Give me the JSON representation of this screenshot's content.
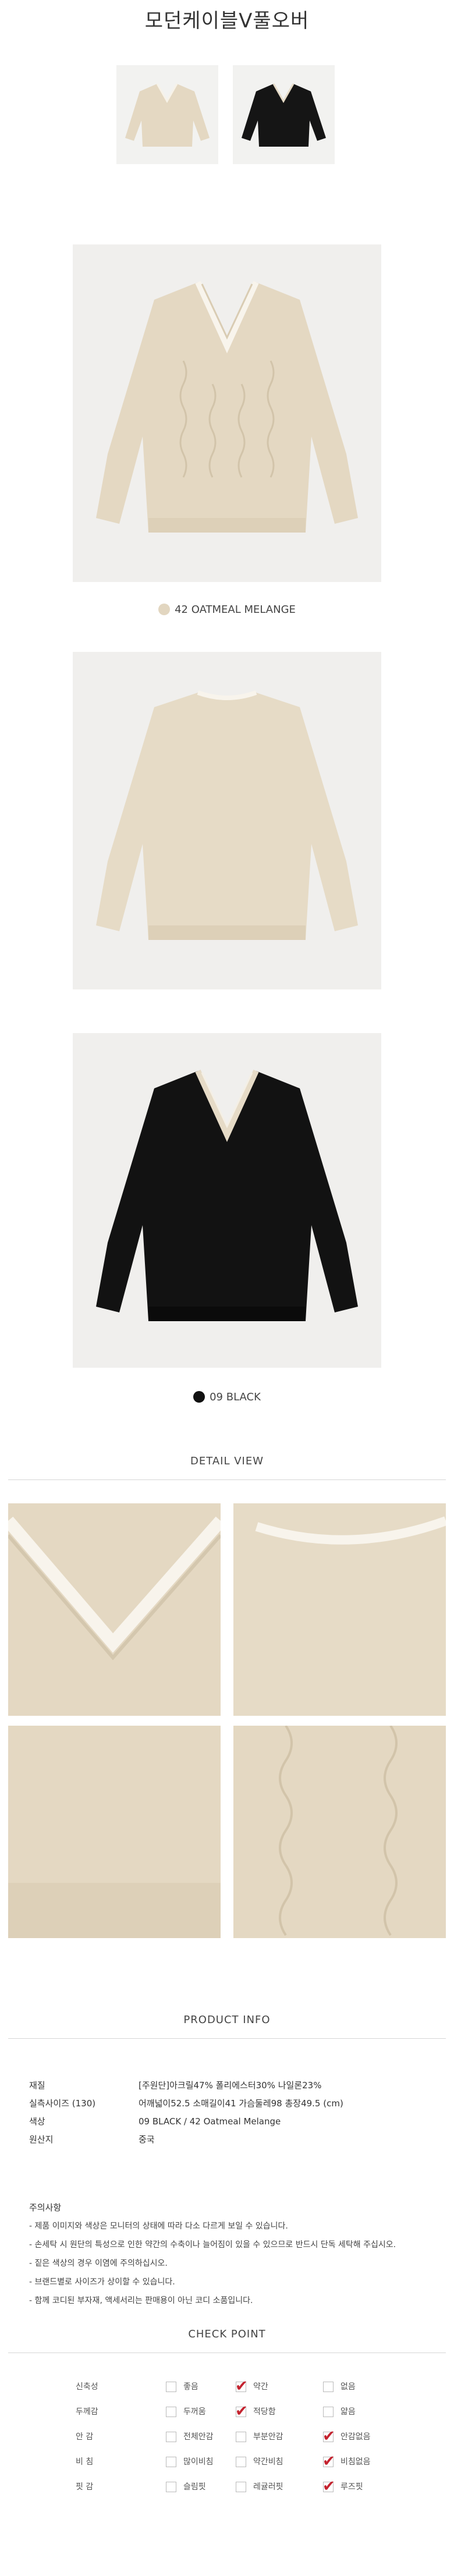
{
  "page_title": "모던케이블V풀오버",
  "colors": {
    "oatmeal": "#e6dbc7",
    "black": "#141414",
    "check_red": "#c4232f",
    "divider": "#d6d6d6"
  },
  "swatches": [
    {
      "caption": "42 OATMEAL MELANGE",
      "color": "#e2d6c0"
    },
    {
      "caption": "09 BLACK",
      "color": "#111111"
    }
  ],
  "detail_view": {
    "title": "DETAIL VIEW"
  },
  "product_info": {
    "title": "PRODUCT INFO",
    "rows": [
      {
        "label": "재질",
        "value": "[주원단]아크릴47% 폴리에스터30% 나일론23%"
      },
      {
        "label": "실측사이즈 (130)",
        "value": "어깨넓이52.5 소매길이41 가슴둘레98 총장49.5 (cm)"
      },
      {
        "label": "색상",
        "value": "09 BLACK / 42 Oatmeal Melange"
      },
      {
        "label": "원산지",
        "value": "중국"
      }
    ]
  },
  "notes": {
    "heading": "주의사항",
    "items": [
      "- 제품 이미지와 색상은 모니터의 상태에 따라 다소 다르게 보일 수 있습니다.",
      "- 손세탁 시 원단의 특성으로 인한 약간의 수축이나 늘어짐이 있을 수 있으므로 반드시 단독 세탁해 주십시오.",
      "- 짙은 색상의 경우 이염에 주의하십시오.",
      "- 브랜드별로 사이즈가 상이할 수 있습니다.",
      "- 함께 코디된 부자재, 액세서리는 판매용이 아닌 코디 소품입니다."
    ]
  },
  "check_point": {
    "title": "CHECK POINT",
    "rows": [
      {
        "label": "신축성",
        "options": [
          {
            "text": "좋음",
            "checked": false
          },
          {
            "text": "약간",
            "checked": true
          },
          {
            "text": "없음",
            "checked": false
          }
        ]
      },
      {
        "label": "두께감",
        "options": [
          {
            "text": "두꺼움",
            "checked": false
          },
          {
            "text": "적당함",
            "checked": true
          },
          {
            "text": "얇음",
            "checked": false
          }
        ]
      },
      {
        "label": "안 감",
        "options": [
          {
            "text": "전체안감",
            "checked": false
          },
          {
            "text": "부분안감",
            "checked": false
          },
          {
            "text": "안감없음",
            "checked": true
          }
        ]
      },
      {
        "label": "비 침",
        "options": [
          {
            "text": "많이비침",
            "checked": false
          },
          {
            "text": "약간비침",
            "checked": false
          },
          {
            "text": "비침없음",
            "checked": true
          }
        ]
      },
      {
        "label": "핏 감",
        "options": [
          {
            "text": "슬림핏",
            "checked": false
          },
          {
            "text": "레귤러핏",
            "checked": false
          },
          {
            "text": "루즈핏",
            "checked": true
          }
        ]
      }
    ]
  }
}
